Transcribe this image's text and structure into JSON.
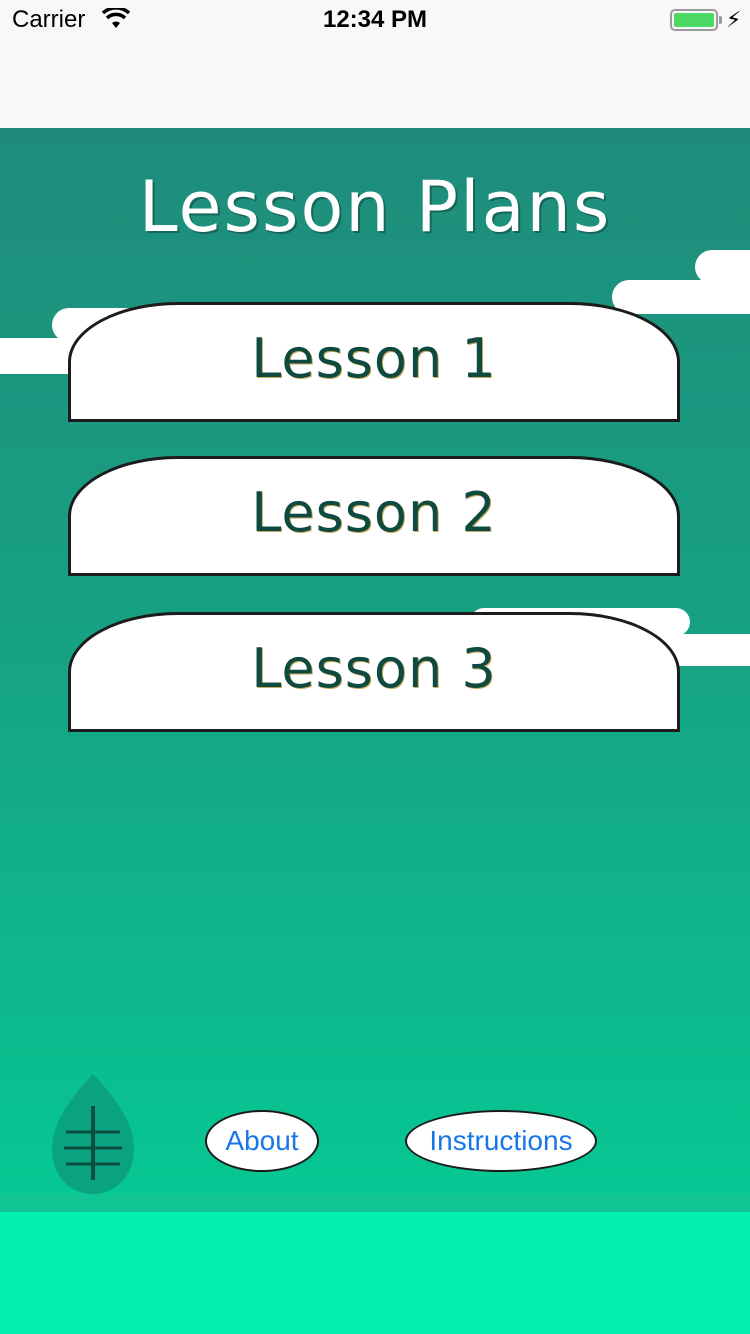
{
  "status_bar": {
    "carrier": "Carrier",
    "time": "12:34 PM",
    "battery_level": 1.0,
    "battery_color": "#4cd964"
  },
  "main": {
    "title": "Lesson Plans",
    "lessons": [
      {
        "label": "Lesson 1"
      },
      {
        "label": "Lesson 2"
      },
      {
        "label": "Lesson 3"
      }
    ]
  },
  "footer": {
    "about_label": "About",
    "instructions_label": "Instructions",
    "link_color": "#1877e6",
    "logo_icon": "leaf-icon"
  },
  "colors": {
    "background_top": "#1f8c7b",
    "background_bottom": "#06c793",
    "ground": "#00efb0"
  }
}
